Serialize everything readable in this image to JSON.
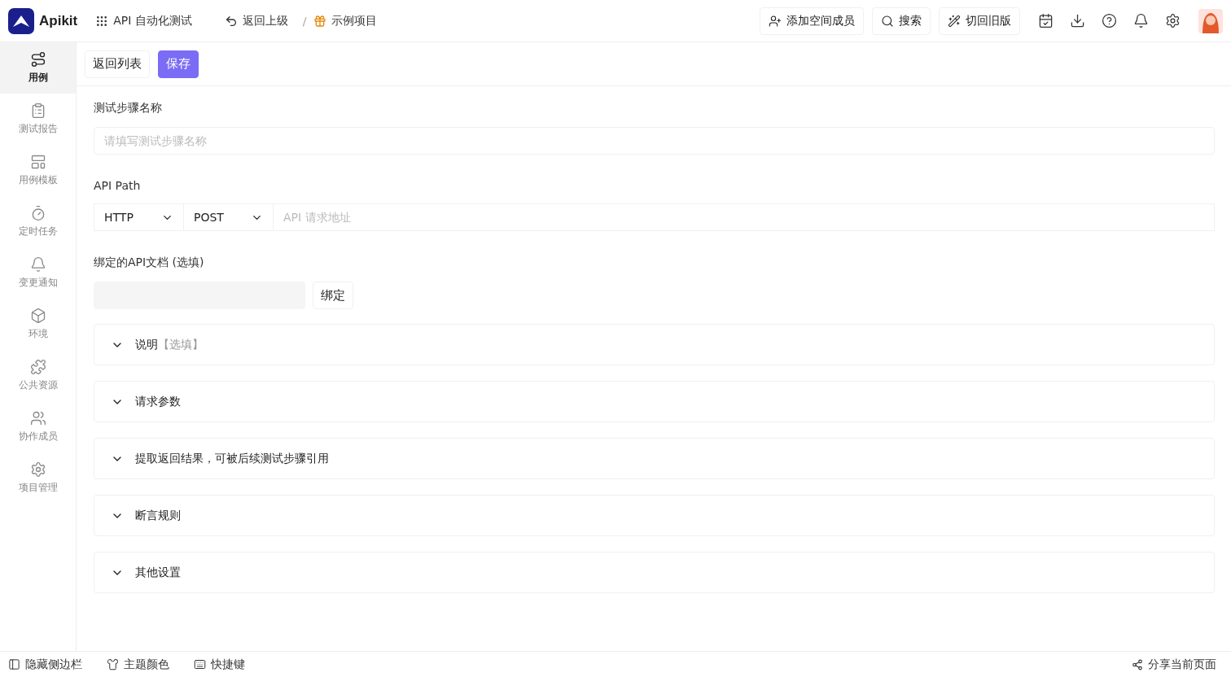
{
  "topbar": {
    "brand": "Apikit",
    "module": "API 自动化测试",
    "back": "返回上级",
    "separator": "/",
    "project": "示例项目",
    "actions": [
      "添加空间成员",
      "搜索",
      "切回旧版"
    ]
  },
  "sidebar": {
    "items": [
      {
        "label": "用例",
        "selected": true
      },
      {
        "label": "测试报告",
        "selected": false
      },
      {
        "label": "用例模板",
        "selected": false
      },
      {
        "label": "定时任务",
        "selected": false
      },
      {
        "label": "变更通知",
        "selected": false
      },
      {
        "label": "环境",
        "selected": false
      },
      {
        "label": "公共资源",
        "selected": false
      },
      {
        "label": "协作成员",
        "selected": false
      },
      {
        "label": "项目管理",
        "selected": false
      }
    ]
  },
  "toolbar": {
    "buttons": [
      {
        "label": "返回列表",
        "kind": "default"
      },
      {
        "label": "保存",
        "kind": "primary"
      }
    ]
  },
  "form": {
    "name_label": "测试步骤名称",
    "name_placeholder": "请填写测试步骤名称",
    "path_label": "API Path",
    "protocol": "HTTP",
    "method": "POST",
    "path_placeholder": "API 请求地址",
    "doc_label": "绑定的API文档 (选填)",
    "bind_button": "绑定"
  },
  "sections": [
    {
      "title": "说明",
      "hint": "【选填】"
    },
    {
      "title": "请求参数"
    },
    {
      "title": "提取返回结果，可被后续测试步骤引用"
    },
    {
      "title": "断言规则"
    },
    {
      "title": "其他设置"
    }
  ],
  "footer": {
    "items": [
      "隐藏侧边栏",
      "主题颜色",
      "快捷键"
    ],
    "share": "分享当前页面"
  }
}
